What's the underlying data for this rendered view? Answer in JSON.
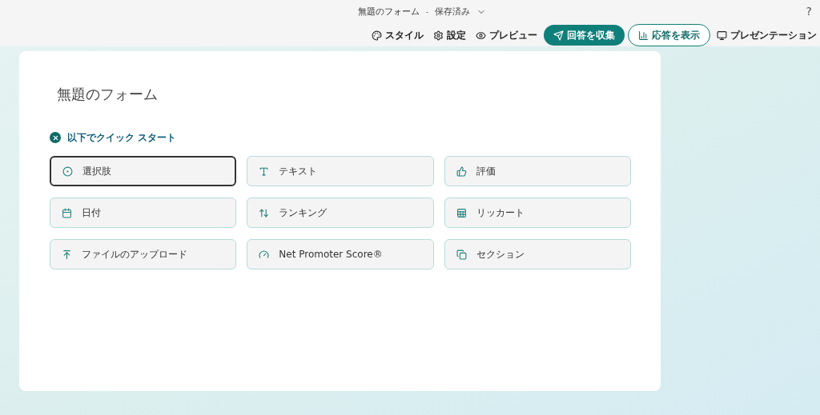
{
  "title_bar": {
    "form_name": "無題のフォーム",
    "separator": "-",
    "save_status": "保存済み",
    "help": "?"
  },
  "toolbar": [
    {
      "label": "スタイル",
      "kind": "plain"
    },
    {
      "label": "設定",
      "kind": "plain"
    },
    {
      "label": "プレビュー",
      "kind": "plain"
    },
    {
      "label": "回答を収集",
      "kind": "primary"
    },
    {
      "label": "応答を表示",
      "kind": "outline"
    },
    {
      "label": "プレゼンテーション",
      "kind": "plain"
    }
  ],
  "form": {
    "title": "無題のフォーム",
    "quick_start": "以下でクイック スタート",
    "question_types": [
      {
        "label": "選択肢",
        "selected": true
      },
      {
        "label": "テキスト",
        "selected": false
      },
      {
        "label": "評価",
        "selected": false
      },
      {
        "label": "日付",
        "selected": false
      },
      {
        "label": "ランキング",
        "selected": false
      },
      {
        "label": "リッカート",
        "selected": false
      },
      {
        "label": "ファイルのアップロード",
        "selected": false
      },
      {
        "label": "Net Promoter Score®",
        "selected": false
      },
      {
        "label": "セクション",
        "selected": false
      }
    ]
  }
}
